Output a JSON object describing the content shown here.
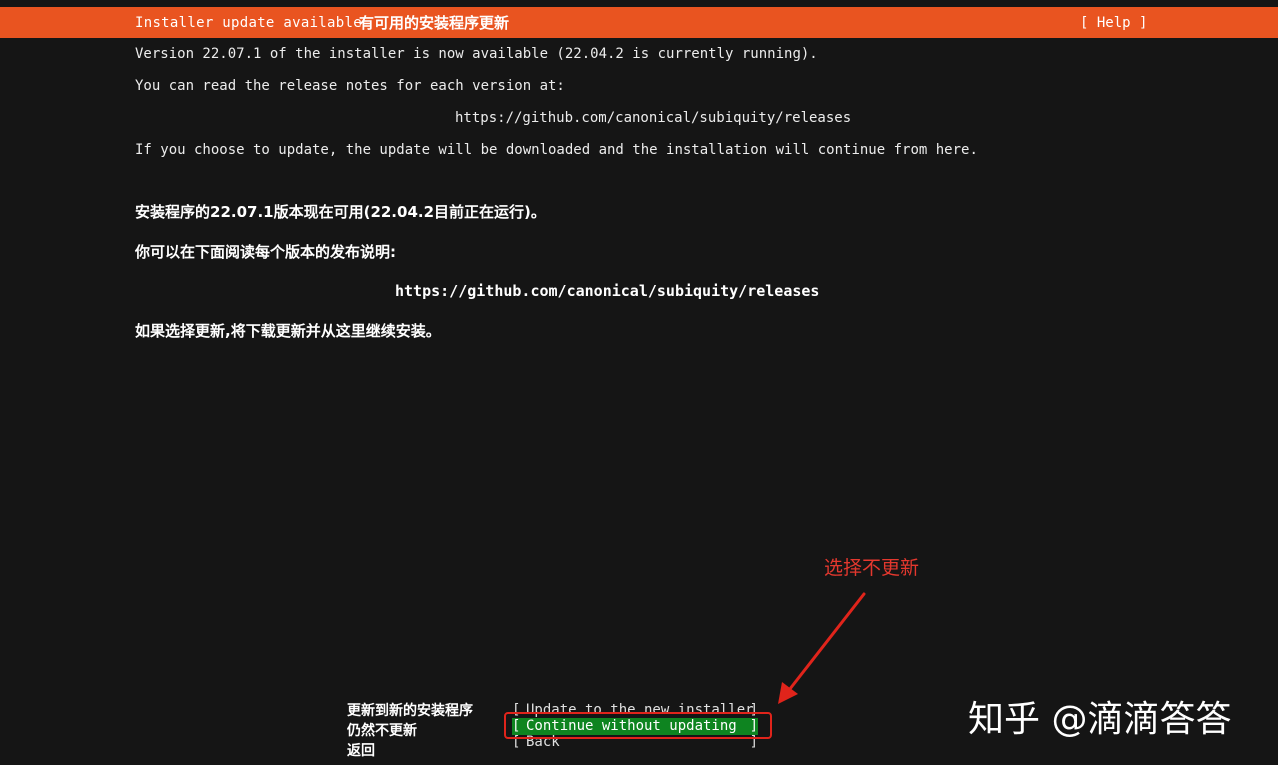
{
  "header": {
    "title_en": "Installer update available",
    "title_zh": "有可用的安装程序更新",
    "help_label": "[ Help ]"
  },
  "content_en": {
    "version_line": "Version 22.07.1 of the installer is now available (22.04.2 is currently running).",
    "read_line": "You can read the release notes for each version at:",
    "url": "https://github.com/canonical/subiquity/releases",
    "update_line": "If you choose to update, the update will be downloaded and the installation will continue from here."
  },
  "content_zh": {
    "version_line": "安装程序的22.07.1版本现在可用(22.04.2目前正在运行)。",
    "read_line": "你可以在下面阅读每个版本的发布说明:",
    "url": "https://github.com/canonical/subiquity/releases",
    "update_line": "如果选择更新,将下载更新并从这里继续安装。"
  },
  "options": [
    {
      "label_zh": "更新到新的安装程序",
      "label": "Update to the new installer",
      "selected": false
    },
    {
      "label_zh": "仍然不更新",
      "label": "Continue without updating",
      "selected": true
    },
    {
      "label_zh": "返回",
      "label": "Back",
      "selected": false
    }
  ],
  "annotation": {
    "text": "选择不更新",
    "color": "#e4382e"
  },
  "watermark": {
    "text": "知乎 @滴滴答答"
  },
  "colors": {
    "header_bg": "#e95420",
    "selected_bg": "#0e8420",
    "screen_bg": "#151515"
  }
}
